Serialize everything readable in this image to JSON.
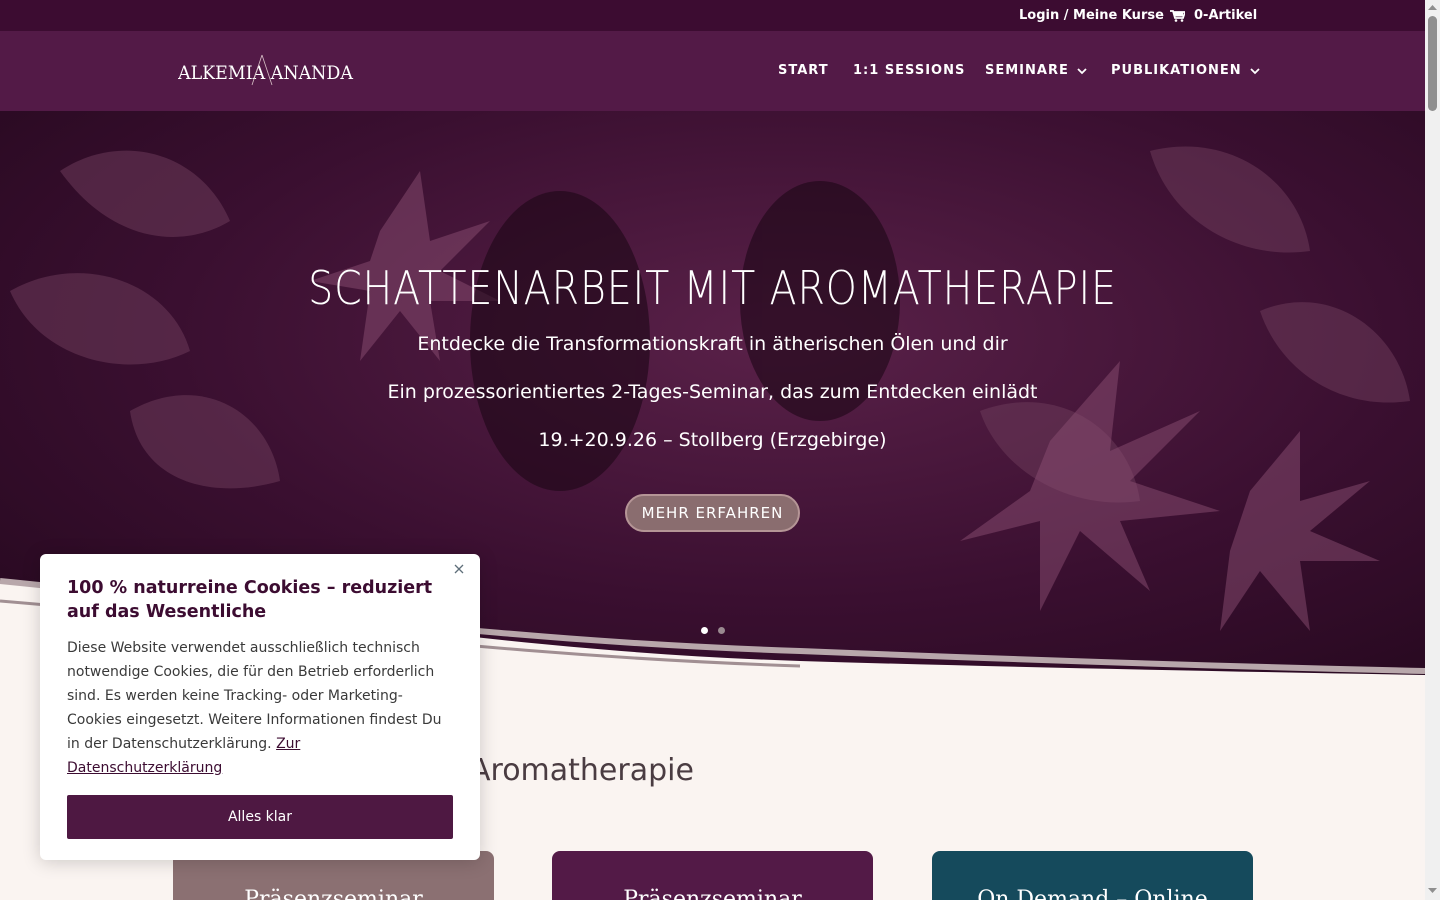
{
  "topbar": {
    "login": "Login / Meine Kurse",
    "cart": "0-Artikel",
    "cart_icon": "cart-icon"
  },
  "logo": {
    "text": "ALKEMIA ANANDA"
  },
  "nav": {
    "items": [
      {
        "label": "START",
        "has_submenu": false
      },
      {
        "label": "1:1 SESSIONS",
        "has_submenu": false
      },
      {
        "label": "SEMINARE",
        "has_submenu": true
      },
      {
        "label": "PUBLIKATIONEN",
        "has_submenu": true
      }
    ]
  },
  "hero": {
    "title": "SCHATTENARBEIT MIT AROMATHERAPIE",
    "subtitle": "Entdecke die Transformationskraft in ätherischen Ölen und dir",
    "description": "Ein prozessorientiertes 2-Tages-Seminar, das zum Entdecken einlädt",
    "date": "19.+20.9.26 – Stollberg (Erzgebirge)",
    "button": "MEHR ERFAHREN",
    "slides": 2,
    "active_slide": 1
  },
  "section": {
    "title": "Aromatherapie"
  },
  "cards": [
    {
      "label": "Präsenzseminar",
      "color": "#8b7072"
    },
    {
      "label": "Präsenzseminar",
      "color": "#531a47"
    },
    {
      "label": "On Demand – Online",
      "color": "#154a5c"
    }
  ],
  "cookie": {
    "title": "100 % naturreine Cookies – reduziert auf das Wesentliche",
    "text": "Diese Website verwendet ausschließlich technisch notwendige Cookies, die für den Betrieb erforderlich sind. Es werden keine Tracking- oder Marketing-Cookies eingesetzt. Weitere Informationen findest Du in der Datenschutzerklärung.",
    "link": "Zur Datenschutzerklärung",
    "button": "Alles klar"
  },
  "colors": {
    "accent": "#531a47",
    "topbar": "#3c0c31",
    "background": "#faf4f1"
  }
}
